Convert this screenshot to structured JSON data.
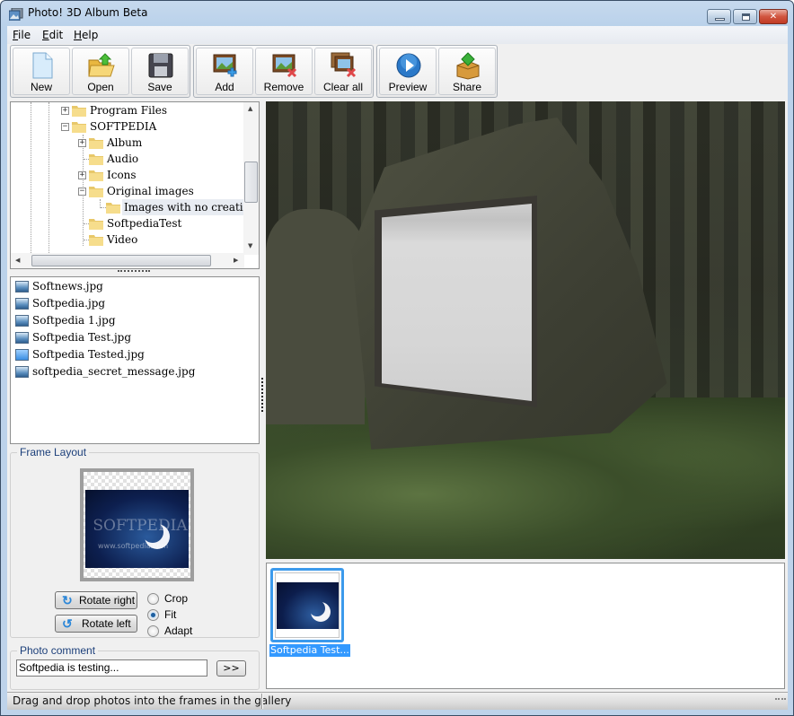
{
  "window": {
    "title": "Photo! 3D Album Beta",
    "controls": {
      "minimize": "minimize",
      "maximize": "maximize",
      "close": "close"
    }
  },
  "menu": [
    {
      "label": "File",
      "accel": "F"
    },
    {
      "label": "Edit",
      "accel": "E"
    },
    {
      "label": "Help",
      "accel": "H"
    }
  ],
  "toolbar": {
    "groups": [
      [
        {
          "label": "New",
          "icon": "new-document-icon"
        },
        {
          "label": "Open",
          "icon": "open-folder-icon"
        },
        {
          "label": "Save",
          "icon": "floppy-disk-icon"
        }
      ],
      [
        {
          "label": "Add",
          "icon": "add-picture-icon"
        },
        {
          "label": "Remove",
          "icon": "remove-picture-icon"
        },
        {
          "label": "Clear all",
          "icon": "clear-all-pictures-icon"
        }
      ],
      [
        {
          "label": "Preview",
          "icon": "play-icon"
        },
        {
          "label": "Share",
          "icon": "share-box-icon"
        }
      ]
    ]
  },
  "folder_tree": {
    "items": [
      {
        "label": "Program Files",
        "level": 0,
        "expander": "+"
      },
      {
        "label": "SOFTPEDIA",
        "level": 0,
        "expander": "-"
      },
      {
        "label": "Album",
        "level": 1,
        "expander": "+"
      },
      {
        "label": "Audio",
        "level": 1,
        "expander": ""
      },
      {
        "label": "Icons",
        "level": 1,
        "expander": "+"
      },
      {
        "label": "Original images",
        "level": 1,
        "expander": "-"
      },
      {
        "label": "Images with no creation d",
        "level": 2,
        "expander": "",
        "selected": true
      },
      {
        "label": "SoftpediaTest",
        "level": 1,
        "expander": ""
      },
      {
        "label": "Video",
        "level": 1,
        "expander": ""
      }
    ]
  },
  "file_list": {
    "items": [
      {
        "label": "Softnews.jpg"
      },
      {
        "label": "Softpedia.jpg"
      },
      {
        "label": "Softpedia 1.jpg"
      },
      {
        "label": "Softpedia Test.jpg"
      },
      {
        "label": "Softpedia Tested.jpg",
        "highlighted": true
      },
      {
        "label": "softpedia_secret_message.jpg"
      }
    ]
  },
  "frame_layout": {
    "title": "Frame Layout",
    "preview_watermark": "SOFTPEDIA",
    "preview_url_text": "www.softpedia.com",
    "rotate_right": "Rotate right",
    "rotate_left": "Rotate left",
    "options": [
      {
        "label": "Crop",
        "checked": false
      },
      {
        "label": "Fit",
        "checked": true
      },
      {
        "label": "Adapt",
        "checked": false
      }
    ]
  },
  "photo_comment": {
    "title": "Photo comment",
    "value": "Softpedia is testing...",
    "submit_label": ">>"
  },
  "gallery": {
    "items": [
      {
        "caption": "Softpedia Test...",
        "selected": true
      }
    ]
  },
  "status": {
    "text": "Drag and drop photos into the frames in the gallery"
  },
  "colors": {
    "selection": "#3399ff",
    "group_title": "#1c3f7a"
  }
}
